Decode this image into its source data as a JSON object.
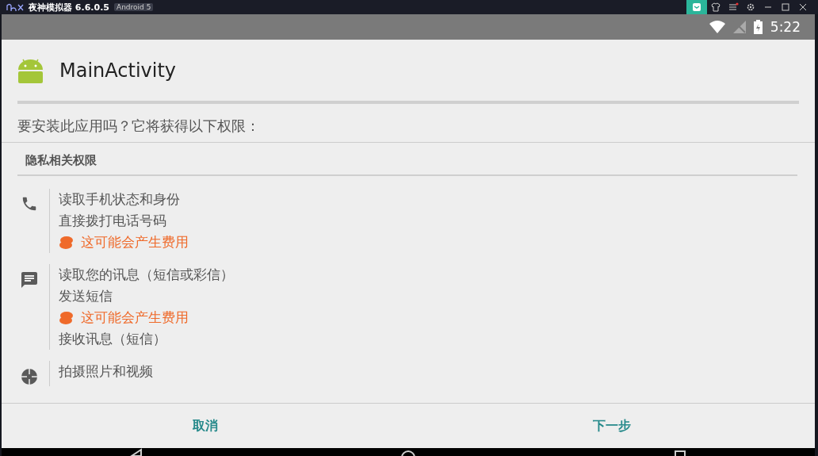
{
  "emulator": {
    "title": "夜神模拟器 6.6.0.5",
    "badge": "Android 5"
  },
  "status_bar": {
    "time": "5:22"
  },
  "app": {
    "name": "MainActivity"
  },
  "prompt": "要安装此应用吗？它将获得以下权限：",
  "section": "隐私相关权限",
  "groups": [
    {
      "kind": "phone",
      "items": [
        {
          "kind": "plain",
          "text": "读取手机状态和身份"
        },
        {
          "kind": "plain",
          "text": "直接拨打电话号码"
        },
        {
          "kind": "cost",
          "text": "这可能会产生费用"
        }
      ]
    },
    {
      "kind": "message",
      "items": [
        {
          "kind": "plain",
          "text": "读取您的讯息（短信或彩信）"
        },
        {
          "kind": "plain",
          "text": "发送短信"
        },
        {
          "kind": "cost",
          "text": "这可能会产生费用"
        },
        {
          "kind": "plain",
          "text": "接收讯息（短信）"
        }
      ]
    },
    {
      "kind": "camera",
      "items": [
        {
          "kind": "plain",
          "text": "拍摄照片和视频"
        }
      ]
    }
  ],
  "buttons": [
    {
      "label": "取消"
    },
    {
      "label": "下一步"
    }
  ]
}
